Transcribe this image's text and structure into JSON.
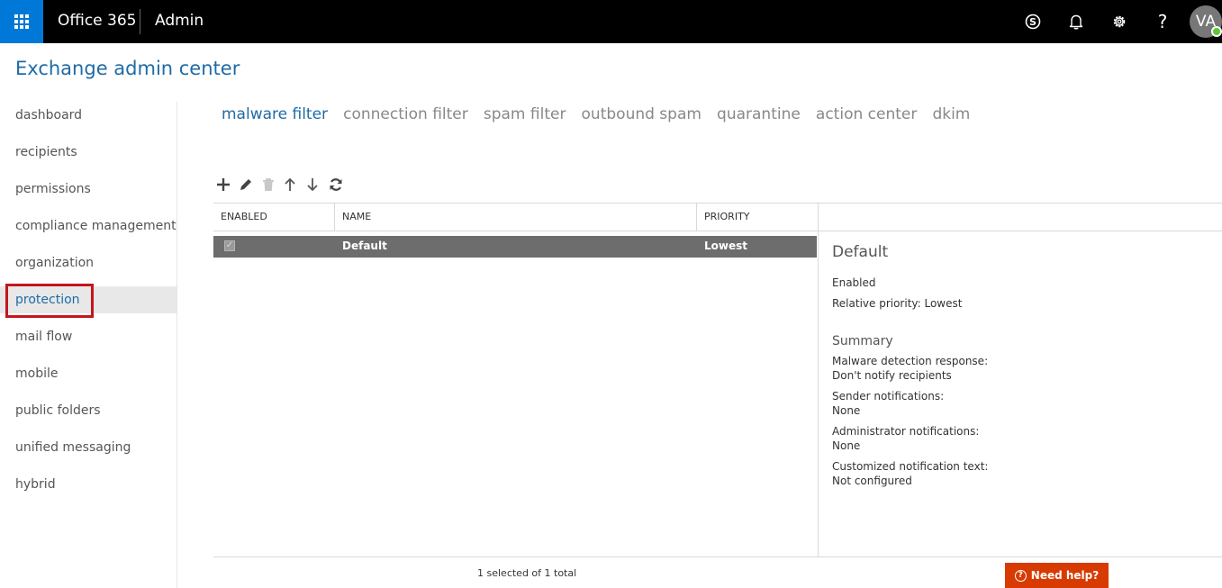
{
  "topbar": {
    "brand": "Office 365",
    "app": "Admin",
    "avatar_initials": "VA",
    "icons": [
      "app-launcher-icon",
      "skype-icon",
      "bell-icon",
      "gear-icon",
      "help-icon"
    ],
    "help_glyph": "?"
  },
  "page_title": "Exchange admin center",
  "sidebar": {
    "items": [
      {
        "label": "dashboard"
      },
      {
        "label": "recipients"
      },
      {
        "label": "permissions"
      },
      {
        "label": "compliance management"
      },
      {
        "label": "organization"
      },
      {
        "label": "protection",
        "selected": true
      },
      {
        "label": "mail flow"
      },
      {
        "label": "mobile"
      },
      {
        "label": "public folders"
      },
      {
        "label": "unified messaging"
      },
      {
        "label": "hybrid"
      }
    ]
  },
  "tabs": [
    {
      "label": "malware filter",
      "active": true
    },
    {
      "label": "connection filter"
    },
    {
      "label": "spam filter"
    },
    {
      "label": "outbound spam"
    },
    {
      "label": "quarantine"
    },
    {
      "label": "action center"
    },
    {
      "label": "dkim"
    }
  ],
  "toolbar": {
    "icons": [
      "add-icon",
      "edit-icon",
      "delete-icon",
      "move-up-icon",
      "move-down-icon",
      "refresh-icon"
    ]
  },
  "list": {
    "columns": [
      "ENABLED",
      "NAME",
      "PRIORITY"
    ],
    "rows": [
      {
        "enabled": true,
        "name": "Default",
        "priority": "Lowest",
        "selected": true
      }
    ],
    "footer": "1 selected of 1 total"
  },
  "details": {
    "title": "Default",
    "status": "Enabled",
    "priority": "Relative priority: Lowest",
    "summary_heading": "Summary",
    "fields": [
      {
        "label": "Malware detection response:",
        "value": "Don't notify recipients"
      },
      {
        "label": "Sender notifications:",
        "value": "None"
      },
      {
        "label": "Administrator notifications:",
        "value": "None"
      },
      {
        "label": "Customized notification text:",
        "value": "Not configured"
      }
    ]
  },
  "need_help": {
    "label": "Need help?"
  },
  "colors": {
    "accent": "#1f6ba6",
    "topbar": "#000000",
    "waffle": "#0078d7",
    "selected_row": "#6d6d6d",
    "need_help": "#d83b01",
    "highlight": "#c4161c"
  }
}
